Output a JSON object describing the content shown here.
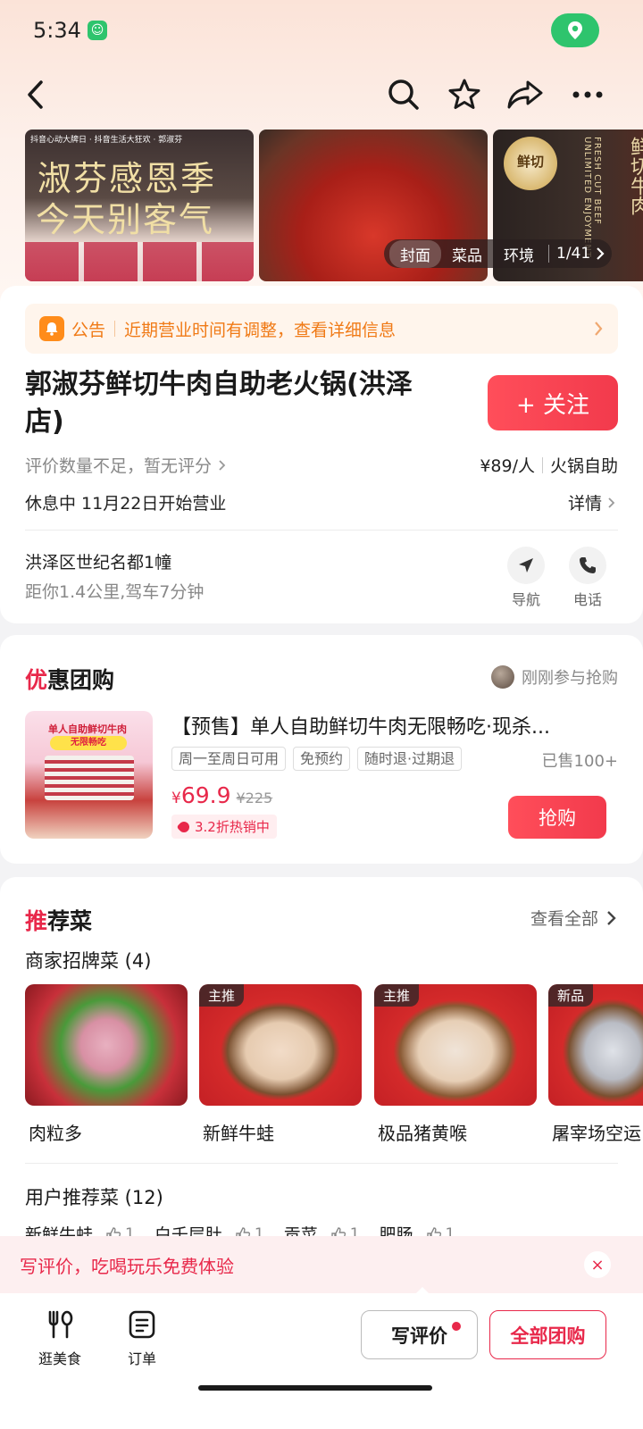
{
  "status_bar": {
    "time": "5:34",
    "app_badge": "☺"
  },
  "gallery": {
    "photo1_title_line1": "淑芬感恩季",
    "photo1_title_line2": "今天别客气",
    "photo1_logos": "抖音心动大牌日 · 抖音生活大狂欢 · 郭淑芬",
    "photo3_seal": "鲜切",
    "photo3_vertical": "鲜切牛肉",
    "photo3_vertical_small": "FRESH CUT BEEF UNLIMITED ENJOYMENT",
    "tabs": [
      "封面",
      "菜品",
      "环境"
    ],
    "active_tab": "封面",
    "counter": "1/41"
  },
  "notice": {
    "label": "公告",
    "text": "近期营业时间有调整，查看详细信息"
  },
  "shop": {
    "name": "郭淑芬鲜切牛肉自助老火锅(洪泽店)",
    "follow_label": "+ 关注",
    "rating_text": "评价数量不足，暂无评分",
    "price": "¥89/人",
    "category": "火锅自助",
    "hours": "休息中 11月22日开始营业",
    "details_label": "详情",
    "address": "洪泽区世纪名都1幢",
    "distance": "距你1.4公里,驾车7分钟",
    "nav_label": "导航",
    "phone_label": "电话"
  },
  "deals": {
    "title_first": "优",
    "title_rest": "惠团购",
    "join_text": "刚刚参与抢购",
    "item": {
      "image_tag": "单人自助鲜切牛肉",
      "image_tag2": "无限畅吃",
      "title": "【预售】单人自助鲜切牛肉无限畅吃·现杀...",
      "tags": [
        "周一至周日可用",
        "免预约",
        "随时退·过期退"
      ],
      "sold": "已售100+",
      "price_symbol": "¥",
      "price": "69.9",
      "original_price": "¥225",
      "hot_label": "3.2折热销中",
      "buy_label": "抢购"
    }
  },
  "recommend": {
    "title_first": "推",
    "title_rest": "荐菜",
    "see_all": "查看全部",
    "signature_title": "商家招牌菜 (4)",
    "dishes": [
      {
        "name": "肉粒多",
        "badge": ""
      },
      {
        "name": "新鲜牛蛙",
        "badge": "主推"
      },
      {
        "name": "极品猪黄喉",
        "badge": "主推"
      },
      {
        "name": "屠宰场空运",
        "badge": "新品"
      }
    ],
    "user_title": "用户推荐菜 (12)",
    "user_dishes": [
      {
        "name": "新鲜牛蛙",
        "likes": "1"
      },
      {
        "name": "白千层肚",
        "likes": "1"
      },
      {
        "name": "贡菜",
        "likes": "1"
      },
      {
        "name": "肥肠",
        "likes": "1"
      }
    ]
  },
  "review_banner": {
    "text": "写评价，吃喝玩乐免费体验",
    "close": "×"
  },
  "tabbar": {
    "food_label": "逛美食",
    "orders_label": "订单",
    "write_review": "写评价",
    "all_deals": "全部团购"
  }
}
